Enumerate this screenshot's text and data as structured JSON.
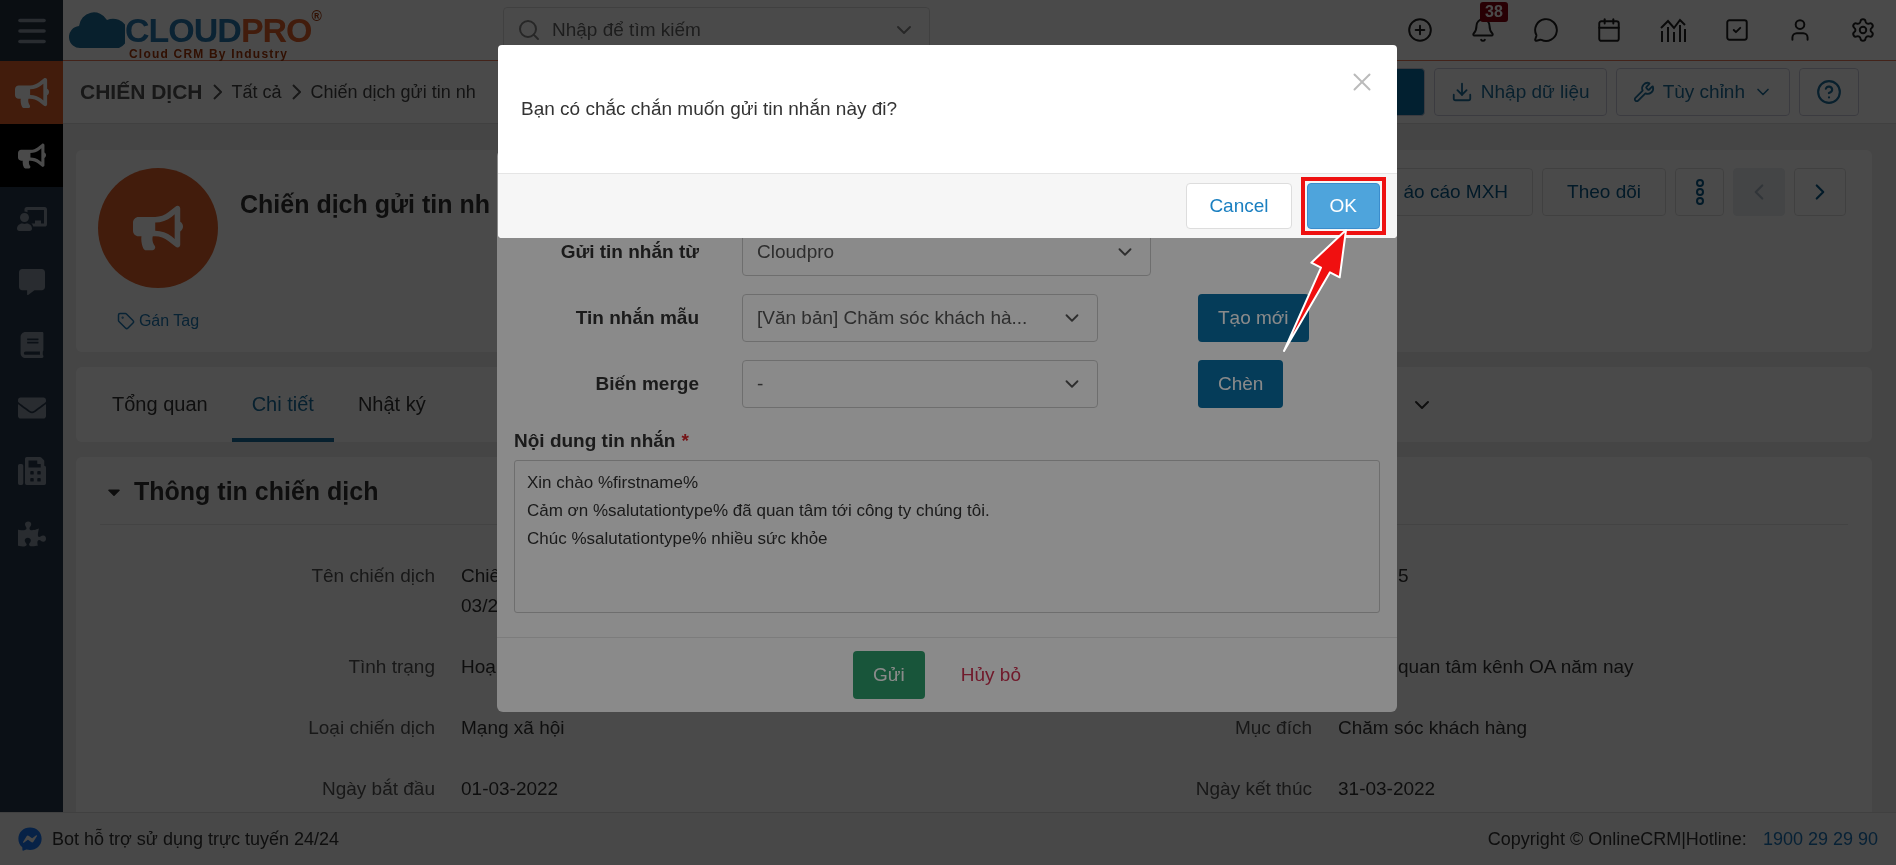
{
  "sidebar": {
    "items": [
      {
        "kind": "menu",
        "selected": false
      },
      {
        "kind": "module",
        "selected": false
      },
      {
        "kind": "campaign",
        "selected": true
      },
      {
        "kind": "board",
        "selected": false
      },
      {
        "kind": "chat",
        "selected": false
      },
      {
        "kind": "book",
        "selected": false
      },
      {
        "kind": "mail",
        "selected": false
      },
      {
        "kind": "fax",
        "selected": false
      },
      {
        "kind": "puzzle",
        "selected": false
      }
    ]
  },
  "header": {
    "logo": {
      "part1": "CLOUD",
      "part2": "PRO",
      "mark": "®",
      "tagline": "Cloud CRM By Industry"
    },
    "search": {
      "placeholder": "Nhập để tìm kiếm"
    },
    "icons": [
      {
        "kind": "add"
      },
      {
        "kind": "bell",
        "badge": "38"
      },
      {
        "kind": "chat"
      },
      {
        "kind": "calendar"
      },
      {
        "kind": "report"
      },
      {
        "kind": "task"
      },
      {
        "kind": "user"
      },
      {
        "kind": "settings"
      }
    ]
  },
  "breadcrumb": [
    "CHIẾN DỊCH",
    "Tất cả",
    "Chiến dịch gửi tin nh"
  ],
  "toolbar": [
    {
      "kind": "primary"
    },
    {
      "kind": "import",
      "label": "Nhập dữ liệu"
    },
    {
      "kind": "customize",
      "label": "Tùy chỉnh"
    },
    {
      "kind": "help"
    }
  ],
  "record": {
    "title": "Chiến dịch gửi tin nh",
    "tag_link": "Gán Tag",
    "actions": [
      {
        "kind": "text",
        "label": "áo cáo MXH",
        "disabled": false
      },
      {
        "kind": "text",
        "label": "Theo dõi",
        "disabled": false
      },
      {
        "kind": "more",
        "disabled": false
      },
      {
        "kind": "prev",
        "disabled": true
      },
      {
        "kind": "next",
        "disabled": false
      }
    ]
  },
  "tabs": [
    {
      "label": "Tổng quan",
      "selected": false
    },
    {
      "label": "Chi tiết",
      "selected": true
    },
    {
      "label": "Nhật ký",
      "selected": false
    }
  ],
  "section": {
    "title": "Thông tin chiến dịch",
    "expanded": true,
    "left": [
      {
        "label": "Tên chiến dịch",
        "value_lines": [
          "Chiế",
          "03/2"
        ]
      },
      {
        "label": "Tình trạng",
        "value": "Hoạ"
      },
      {
        "label": "Loại chiến dịch",
        "value": "Mạng xã hội"
      },
      {
        "label": "Ngày bắt đầu",
        "value": "01-03-2022"
      }
    ],
    "right": [
      {
        "value": "5"
      },
      {
        "value": "quan tâm kênh OA năm nay"
      },
      {
        "label": "Mục đích",
        "value": "Chăm sóc khách hàng"
      },
      {
        "label": "Ngày kết thúc",
        "value": "31-03-2022"
      }
    ]
  },
  "form_modal": {
    "fields": [
      {
        "label": "Gửi tin nhắn từ",
        "value": "Cloudpro"
      },
      {
        "label": "Tin nhắn mẫu",
        "value": "[Văn bản] Chăm sóc khách hà...",
        "action": "Tạo mới"
      },
      {
        "label": "Biến merge",
        "value": "-",
        "action": "Chèn"
      }
    ],
    "message": {
      "label": "Nội dung tin nhắn",
      "required_mark": "*",
      "lines": [
        "Xin chào %firstname%",
        "Cảm ơn %salutationtype% đã quan tâm tới công ty chúng tôi.",
        "Chúc %salutationtype% nhiều sức khỏe"
      ]
    },
    "buttons": [
      {
        "label": "Gửi",
        "kind": "success"
      },
      {
        "label": "Hủy bỏ",
        "kind": "link"
      }
    ]
  },
  "confirm": {
    "message": "Bạn có chắc chắn muốn gửi tin nhắn này đi?",
    "buttons": [
      {
        "label": "Cancel",
        "kind": "secondary",
        "highlighted": false
      },
      {
        "label": "OK",
        "kind": "primary",
        "highlighted": true
      }
    ]
  },
  "footer": {
    "chat_text": "Bot hỗ trợ sử dụng trực tuyến 24/24",
    "copyright": "Copyright © OnlineCRM|Hotline:",
    "hotline": "1900 29 29 90"
  }
}
